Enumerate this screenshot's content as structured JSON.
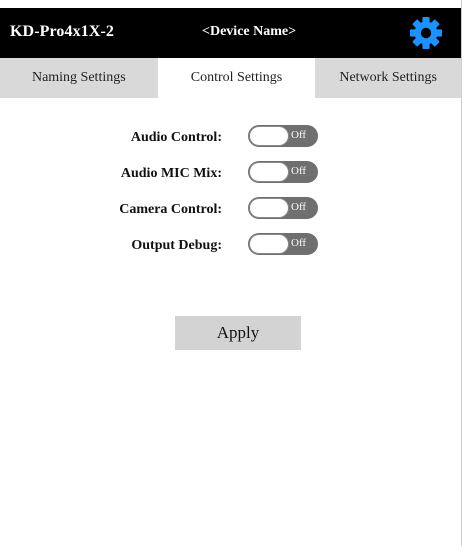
{
  "header": {
    "model": "KD-Pro4x1X-2",
    "device_name": "<Device Name>",
    "settings_icon": "gear-icon",
    "accent_color": "#1e90ff"
  },
  "tabs": [
    {
      "label": "Naming Settings",
      "active": false
    },
    {
      "label": "Control Settings",
      "active": true
    },
    {
      "label": "Network Settings",
      "active": false
    }
  ],
  "controls": [
    {
      "label": "Audio Control:",
      "state": "Off"
    },
    {
      "label": "Audio MIC Mix:",
      "state": "Off"
    },
    {
      "label": "Camera Control:",
      "state": "Off"
    },
    {
      "label": "Output Debug:",
      "state": "Off"
    }
  ],
  "apply_label": "Apply"
}
